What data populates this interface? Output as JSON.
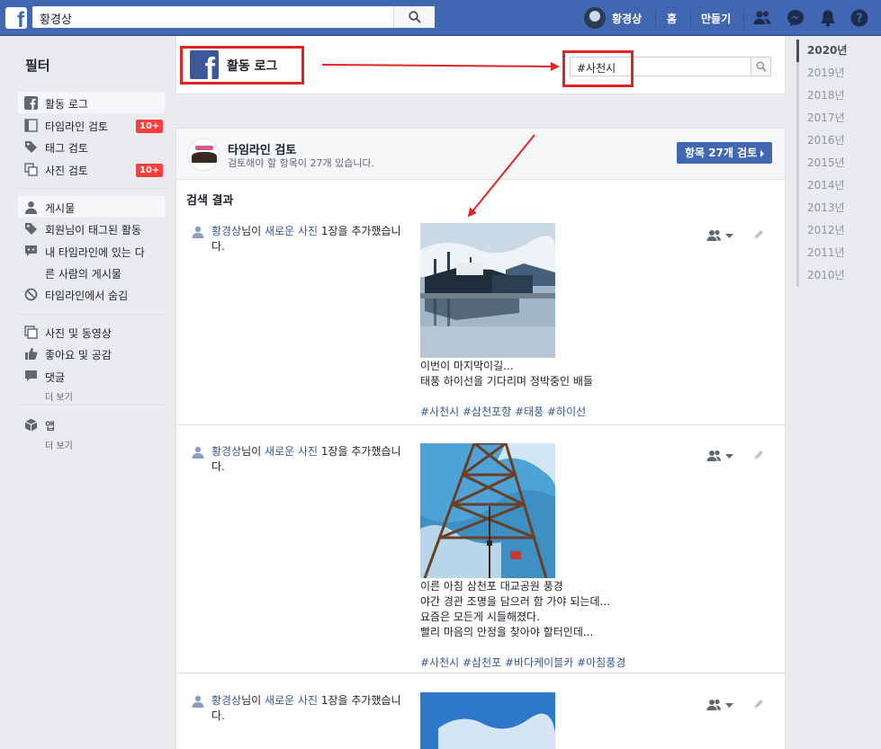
{
  "topbar": {
    "search_value": "황경상",
    "profile_name": "황경상",
    "nav_home": "홈",
    "nav_create": "만들기"
  },
  "sidebar": {
    "title": "필터",
    "items": [
      {
        "label": "활동 로그",
        "icon": "facebook-icon"
      },
      {
        "label": "타임라인 검토",
        "icon": "timeline-icon",
        "badge": "10+"
      },
      {
        "label": "태그 검토",
        "icon": "tag-icon"
      },
      {
        "label": "사진 검토",
        "icon": "photos-icon",
        "badge": "10+"
      },
      {
        "label": "게시물",
        "icon": "person-icon"
      },
      {
        "label": "회원님이 태그된 활동",
        "icon": "tag-icon"
      },
      {
        "label": "내 타임라인에 있는 다",
        "icon": "comment-icon"
      },
      {
        "label": "른 사람의 게시물"
      },
      {
        "label": "타임라인에서 숨김",
        "icon": "block-icon"
      },
      {
        "label": "사진 및 동영상",
        "icon": "photos-icon"
      },
      {
        "label": "좋아요 및 공감",
        "icon": "like-icon"
      },
      {
        "label": "댓글",
        "icon": "comment-icon"
      },
      {
        "label": "앱",
        "icon": "app-cube-icon"
      }
    ],
    "more_1": "더 보기",
    "more_2": "더 보기"
  },
  "header": {
    "title": "활동 로그",
    "search_value": "#사천시"
  },
  "review": {
    "title": "타임라인 검토",
    "subtitle": "검토해야 할 항목이 27개 있습니다.",
    "button": "항목 27개 검토"
  },
  "results": {
    "title": "검색 결과",
    "posts": [
      {
        "author": "황경상",
        "mid": "님이 ",
        "action": "새로운 사진",
        "tail": " 1장을 추가했습니다.",
        "caption": [
          "이번이 마지막이길...",
          "태풍 하이선을 기다리며 정박중인 배들"
        ],
        "tags": "#사천시 #삼천포항 #태풍 #하이선"
      },
      {
        "author": "황경상",
        "mid": "님이 ",
        "action": "새로운 사진",
        "tail": " 1장을 추가했습니다.",
        "caption": [
          "이른 아침 삼천포 대교공원 풍경",
          "야간 경관 조명을 담으러 함 가야 되는데...",
          "요즘은 모든게 시들해졌다.",
          "빨리 마음의 안정을 찾아야 할터인데..."
        ],
        "tags": "#사천시 #삼천포 #바다케이블카 #아침풍경"
      },
      {
        "author": "황경상",
        "mid": "님이 ",
        "action": "새로운 사진",
        "tail": " 1장을 추가했습니다."
      }
    ]
  },
  "years": [
    "2020년",
    "2019년",
    "2018년",
    "2017년",
    "2016년",
    "2015년",
    "2014년",
    "2013년",
    "2012년",
    "2011년",
    "2010년"
  ],
  "colors": {
    "brand": "#4267b2",
    "link": "#365899",
    "badge": "#fa3e3e",
    "annotation": "#e02525"
  }
}
